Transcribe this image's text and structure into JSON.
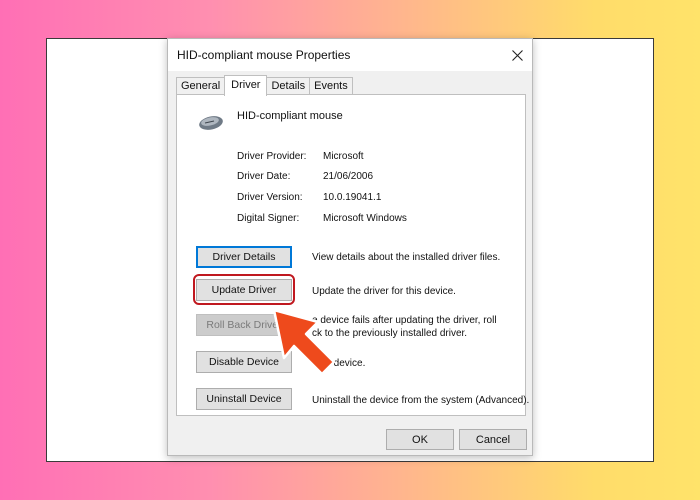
{
  "dialog": {
    "title": "HID-compliant mouse Properties",
    "close_icon": "close-icon"
  },
  "tabs": [
    {
      "label": "General"
    },
    {
      "label": "Driver",
      "active": true
    },
    {
      "label": "Details"
    },
    {
      "label": "Events"
    }
  ],
  "device": {
    "icon": "mouse-icon",
    "name": "HID-compliant mouse"
  },
  "info": [
    {
      "key": "Driver Provider:",
      "value": "Microsoft"
    },
    {
      "key": "Driver Date:",
      "value": "21/06/2006"
    },
    {
      "key": "Driver Version:",
      "value": "10.0.19041.1"
    },
    {
      "key": "Digital Signer:",
      "value": "Microsoft Windows"
    }
  ],
  "actions": [
    {
      "label": "Driver Details",
      "desc1": "View details about the installed driver files.",
      "desc2": ""
    },
    {
      "label": "Update Driver",
      "desc1": "Update the driver for this device.",
      "desc2": ""
    },
    {
      "label": "Roll Back Driver",
      "desc1": "e device fails after updating the driver, roll",
      "desc2": "ck to the previously installed driver."
    },
    {
      "label": "Disable Device",
      "desc1": "the device.",
      "desc2": ""
    },
    {
      "label": "Uninstall Device",
      "desc1": "Uninstall the device from the system (Advanced).",
      "desc2": ""
    }
  ],
  "footer": {
    "ok": "OK",
    "cancel": "Cancel"
  },
  "annotation": {
    "highlight_color": "#c0181f",
    "arrow_color": "#ee4a1c"
  }
}
